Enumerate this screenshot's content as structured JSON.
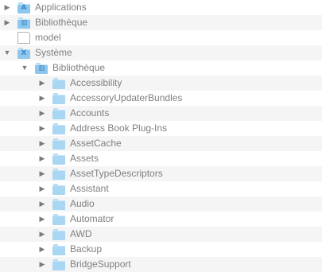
{
  "tree": {
    "items": [
      {
        "label": "Applications",
        "level": 0,
        "expanded": false,
        "icon": "applications-folder-icon"
      },
      {
        "label": "Bibliothèque",
        "level": 0,
        "expanded": false,
        "icon": "library-folder-icon"
      },
      {
        "label": "model",
        "level": 0,
        "expanded": null,
        "icon": "document-icon"
      },
      {
        "label": "Système",
        "level": 0,
        "expanded": true,
        "icon": "system-folder-icon"
      },
      {
        "label": "Bibliothèque",
        "level": 1,
        "expanded": true,
        "icon": "library-folder-icon"
      },
      {
        "label": "Accessibility",
        "level": 2,
        "expanded": false,
        "icon": "folder-icon"
      },
      {
        "label": "AccessoryUpdaterBundles",
        "level": 2,
        "expanded": false,
        "icon": "folder-icon"
      },
      {
        "label": "Accounts",
        "level": 2,
        "expanded": false,
        "icon": "folder-icon"
      },
      {
        "label": "Address Book Plug-Ins",
        "level": 2,
        "expanded": false,
        "icon": "folder-icon"
      },
      {
        "label": "AssetCache",
        "level": 2,
        "expanded": false,
        "icon": "folder-icon"
      },
      {
        "label": "Assets",
        "level": 2,
        "expanded": false,
        "icon": "folder-icon"
      },
      {
        "label": "AssetTypeDescriptors",
        "level": 2,
        "expanded": false,
        "icon": "folder-icon"
      },
      {
        "label": "Assistant",
        "level": 2,
        "expanded": false,
        "icon": "folder-icon"
      },
      {
        "label": "Audio",
        "level": 2,
        "expanded": false,
        "icon": "folder-icon"
      },
      {
        "label": "Automator",
        "level": 2,
        "expanded": false,
        "icon": "folder-icon"
      },
      {
        "label": "AWD",
        "level": 2,
        "expanded": false,
        "icon": "folder-icon"
      },
      {
        "label": "Backup",
        "level": 2,
        "expanded": false,
        "icon": "folder-icon"
      },
      {
        "label": "BridgeSupport",
        "level": 2,
        "expanded": false,
        "icon": "folder-icon"
      }
    ]
  },
  "glyphs": {
    "collapsed": "▶",
    "expanded": "▼"
  },
  "colors": {
    "text": "#808080",
    "folder": "#a9d6f2",
    "row_alt": "#f5f5f5"
  }
}
